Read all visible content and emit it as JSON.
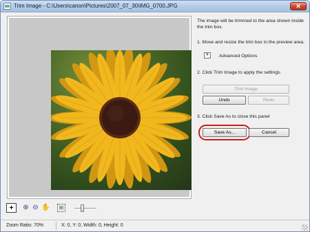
{
  "window": {
    "title": "Trim Image - C:\\Users\\canon\\Pictures\\2007_07_30\\IMG_0700.JPG",
    "close_glyph": "✕"
  },
  "panel": {
    "intro": [
      "The image will be trimmed to the area shown inside",
      "the trim box."
    ],
    "step1": "1.  Move and resize the trim box in the preview area.",
    "advanced_options": "Advanced Options",
    "step2": "2.  Click Trim Image to apply the settings.",
    "trim_image": "Trim Image",
    "undo": "Undo",
    "redo": "Redo",
    "step3": "3.  Click Save As to close this panel",
    "save_as": "Save As...",
    "cancel": "Cancel"
  },
  "toolbar": {
    "add_glyph": "+",
    "zoom_in_glyph": "⊕",
    "zoom_out_glyph": "⊖",
    "hand_glyph": "✋",
    "fit_glyph": "⊞",
    "zoom_slider_position": 0.35,
    "icons": [
      "add-trim-icon",
      "zoom-in-icon",
      "zoom-out-icon",
      "hand-icon",
      "fit-icon"
    ]
  },
  "status": {
    "zoom_ratio": "Zoom Ratio: 70%",
    "coords": "X: 0, Y: 0, Width: 0, Height: 0"
  },
  "colors": {
    "highlight": "#d2161b",
    "petal": "#f1b81e",
    "center": "#3a1a12"
  }
}
